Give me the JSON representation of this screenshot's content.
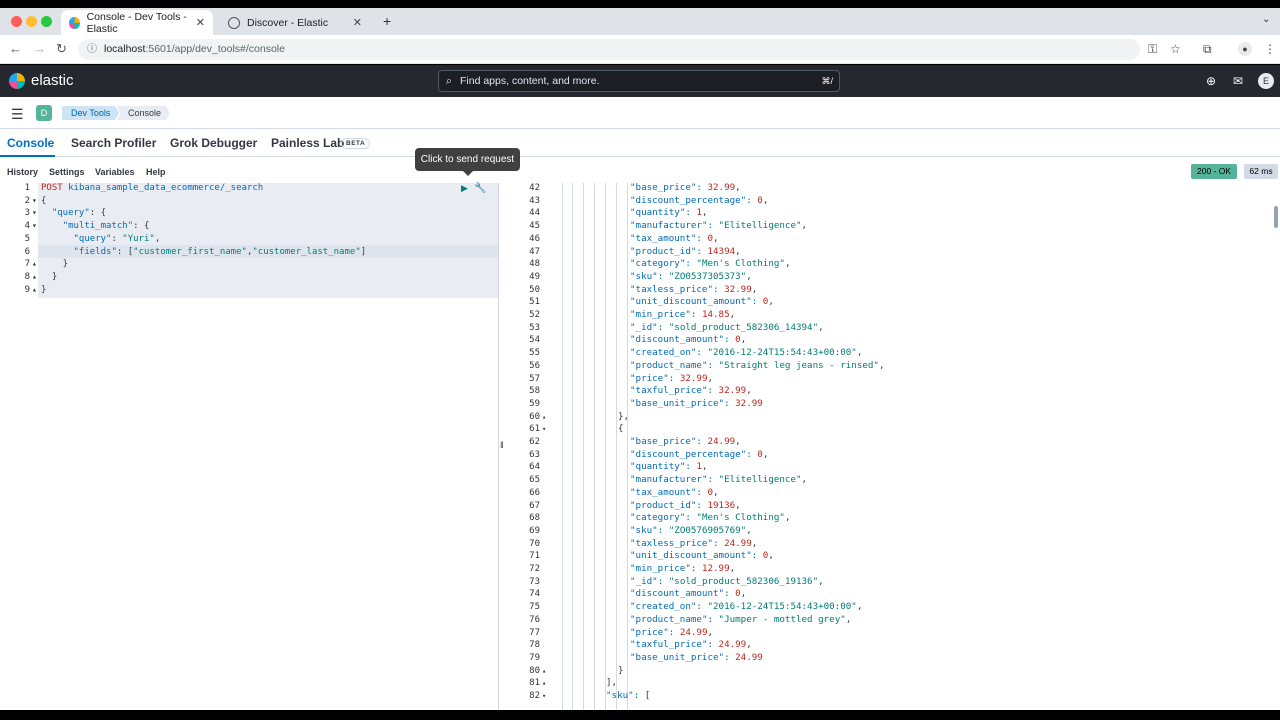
{
  "browser": {
    "tabs": [
      {
        "label": "Console - Dev Tools - Elastic",
        "active": true
      },
      {
        "label": "Discover - Elastic",
        "active": false
      }
    ],
    "new_tab": "+",
    "url_host": "localhost",
    "url_path": ":5601/app/dev_tools#/console"
  },
  "header": {
    "logo_text": "elastic",
    "search_placeholder": "Find apps, content, and more.",
    "search_shortcut": "⌘/",
    "avatar_letter": "E"
  },
  "breadcrumb": {
    "space_letter": "D",
    "items": [
      "Dev Tools",
      "Console"
    ]
  },
  "app_tabs": [
    {
      "label": "Console",
      "selected": true
    },
    {
      "label": "Search Profiler",
      "selected": false
    },
    {
      "label": "Grok Debugger",
      "selected": false
    },
    {
      "label": "Painless Lab",
      "selected": false
    }
  ],
  "beta_badge": "BETA",
  "menu": [
    "History",
    "Settings",
    "Variables",
    "Help"
  ],
  "tooltip": "Click to send request",
  "status": {
    "code": "200 - OK",
    "time": "62 ms",
    "color": "#54b399"
  },
  "request": {
    "method": "POST",
    "path": "kibana_sample_data_ecommerce/_search",
    "lines": [
      {
        "n": "1",
        "fold": ""
      },
      {
        "n": "2",
        "fold": "▾"
      },
      {
        "n": "3",
        "fold": "▾"
      },
      {
        "n": "4",
        "fold": "▾"
      },
      {
        "n": "5",
        "fold": ""
      },
      {
        "n": "6",
        "fold": ""
      },
      {
        "n": "7",
        "fold": "▴"
      },
      {
        "n": "8",
        "fold": "▴"
      },
      {
        "n": "9",
        "fold": "▴"
      }
    ],
    "query_value": "Yuri",
    "field_one": "customer_first_name",
    "field_two": "customer_last_name"
  },
  "response": {
    "lines": [
      {
        "n": "42",
        "fold": "",
        "indent": 4,
        "k": "base_price",
        "v": "32.99",
        "t": "num",
        "tail": ","
      },
      {
        "n": "43",
        "fold": "",
        "indent": 4,
        "k": "discount_percentage",
        "v": "0",
        "t": "num",
        "tail": ","
      },
      {
        "n": "44",
        "fold": "",
        "indent": 4,
        "k": "quantity",
        "v": "1",
        "t": "num",
        "tail": ","
      },
      {
        "n": "45",
        "fold": "",
        "indent": 4,
        "k": "manufacturer",
        "v": "\"Elitelligence\"",
        "t": "str",
        "tail": ","
      },
      {
        "n": "46",
        "fold": "",
        "indent": 4,
        "k": "tax_amount",
        "v": "0",
        "t": "num",
        "tail": ","
      },
      {
        "n": "47",
        "fold": "",
        "indent": 4,
        "k": "product_id",
        "v": "14394",
        "t": "num",
        "tail": ","
      },
      {
        "n": "48",
        "fold": "",
        "indent": 4,
        "k": "category",
        "v": "\"Men's Clothing\"",
        "t": "str",
        "tail": ","
      },
      {
        "n": "49",
        "fold": "",
        "indent": 4,
        "k": "sku",
        "v": "\"ZO0537305373\"",
        "t": "str",
        "tail": ","
      },
      {
        "n": "50",
        "fold": "",
        "indent": 4,
        "k": "taxless_price",
        "v": "32.99",
        "t": "num",
        "tail": ","
      },
      {
        "n": "51",
        "fold": "",
        "indent": 4,
        "k": "unit_discount_amount",
        "v": "0",
        "t": "num",
        "tail": ","
      },
      {
        "n": "52",
        "fold": "",
        "indent": 4,
        "k": "min_price",
        "v": "14.85",
        "t": "num",
        "tail": ","
      },
      {
        "n": "53",
        "fold": "",
        "indent": 4,
        "k": "_id",
        "v": "\"sold_product_582306_14394\"",
        "t": "str",
        "tail": ","
      },
      {
        "n": "54",
        "fold": "",
        "indent": 4,
        "k": "discount_amount",
        "v": "0",
        "t": "num",
        "tail": ","
      },
      {
        "n": "55",
        "fold": "",
        "indent": 4,
        "k": "created_on",
        "v": "\"2016-12-24T15:54:43+00:00\"",
        "t": "str",
        "tail": ","
      },
      {
        "n": "56",
        "fold": "",
        "indent": 4,
        "k": "product_name",
        "v": "\"Straight leg jeans - rinsed\"",
        "t": "str",
        "tail": ","
      },
      {
        "n": "57",
        "fold": "",
        "indent": 4,
        "k": "price",
        "v": "32.99",
        "t": "num",
        "tail": ","
      },
      {
        "n": "58",
        "fold": "",
        "indent": 4,
        "k": "taxful_price",
        "v": "32.99",
        "t": "num",
        "tail": ","
      },
      {
        "n": "59",
        "fold": "",
        "indent": 4,
        "k": "base_unit_price",
        "v": "32.99",
        "t": "num",
        "tail": ""
      },
      {
        "n": "60",
        "fold": "▴",
        "indent": 3,
        "k": "",
        "v": "},",
        "t": "punct",
        "tail": ""
      },
      {
        "n": "61",
        "fold": "▾",
        "indent": 3,
        "k": "",
        "v": "{",
        "t": "punct",
        "tail": ""
      },
      {
        "n": "62",
        "fold": "",
        "indent": 4,
        "k": "base_price",
        "v": "24.99",
        "t": "num",
        "tail": ","
      },
      {
        "n": "63",
        "fold": "",
        "indent": 4,
        "k": "discount_percentage",
        "v": "0",
        "t": "num",
        "tail": ","
      },
      {
        "n": "64",
        "fold": "",
        "indent": 4,
        "k": "quantity",
        "v": "1",
        "t": "num",
        "tail": ","
      },
      {
        "n": "65",
        "fold": "",
        "indent": 4,
        "k": "manufacturer",
        "v": "\"Elitelligence\"",
        "t": "str",
        "tail": ","
      },
      {
        "n": "66",
        "fold": "",
        "indent": 4,
        "k": "tax_amount",
        "v": "0",
        "t": "num",
        "tail": ","
      },
      {
        "n": "67",
        "fold": "",
        "indent": 4,
        "k": "product_id",
        "v": "19136",
        "t": "num",
        "tail": ","
      },
      {
        "n": "68",
        "fold": "",
        "indent": 4,
        "k": "category",
        "v": "\"Men's Clothing\"",
        "t": "str",
        "tail": ","
      },
      {
        "n": "69",
        "fold": "",
        "indent": 4,
        "k": "sku",
        "v": "\"ZO0576905769\"",
        "t": "str",
        "tail": ","
      },
      {
        "n": "70",
        "fold": "",
        "indent": 4,
        "k": "taxless_price",
        "v": "24.99",
        "t": "num",
        "tail": ","
      },
      {
        "n": "71",
        "fold": "",
        "indent": 4,
        "k": "unit_discount_amount",
        "v": "0",
        "t": "num",
        "tail": ","
      },
      {
        "n": "72",
        "fold": "",
        "indent": 4,
        "k": "min_price",
        "v": "12.99",
        "t": "num",
        "tail": ","
      },
      {
        "n": "73",
        "fold": "",
        "indent": 4,
        "k": "_id",
        "v": "\"sold_product_582306_19136\"",
        "t": "str",
        "tail": ","
      },
      {
        "n": "74",
        "fold": "",
        "indent": 4,
        "k": "discount_amount",
        "v": "0",
        "t": "num",
        "tail": ","
      },
      {
        "n": "75",
        "fold": "",
        "indent": 4,
        "k": "created_on",
        "v": "\"2016-12-24T15:54:43+00:00\"",
        "t": "str",
        "tail": ","
      },
      {
        "n": "76",
        "fold": "",
        "indent": 4,
        "k": "product_name",
        "v": "\"Jumper - mottled grey\"",
        "t": "str",
        "tail": ","
      },
      {
        "n": "77",
        "fold": "",
        "indent": 4,
        "k": "price",
        "v": "24.99",
        "t": "num",
        "tail": ","
      },
      {
        "n": "78",
        "fold": "",
        "indent": 4,
        "k": "taxful_price",
        "v": "24.99",
        "t": "num",
        "tail": ","
      },
      {
        "n": "79",
        "fold": "",
        "indent": 4,
        "k": "base_unit_price",
        "v": "24.99",
        "t": "num",
        "tail": ""
      },
      {
        "n": "80",
        "fold": "▴",
        "indent": 3,
        "k": "",
        "v": "}",
        "t": "punct",
        "tail": ""
      },
      {
        "n": "81",
        "fold": "▴",
        "indent": 2,
        "k": "",
        "v": "],",
        "t": "punct",
        "tail": ""
      },
      {
        "n": "82",
        "fold": "▾",
        "indent": 2,
        "k": "sku",
        "v": "[",
        "t": "punct",
        "tail": ""
      }
    ]
  }
}
